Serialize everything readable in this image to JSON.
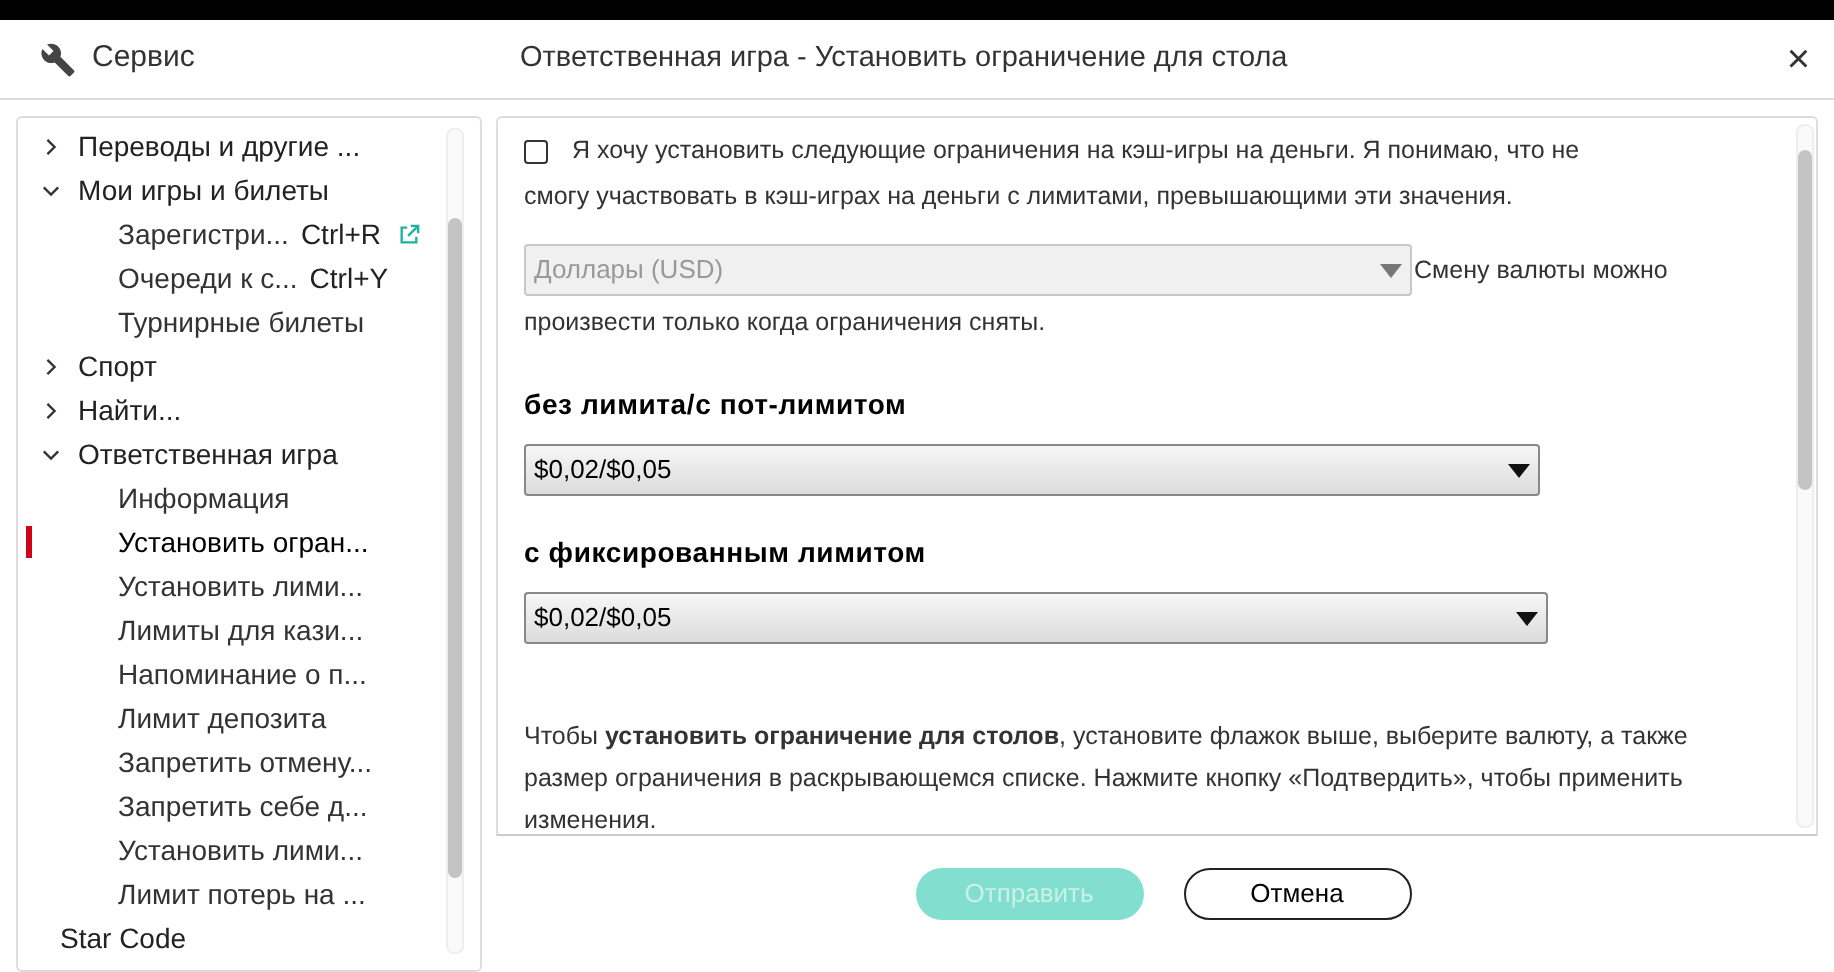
{
  "window": {
    "menu_label": "Сервис",
    "title": "Ответственная игра - Установить ограничение для стола",
    "close": "×"
  },
  "sidebar": {
    "items": [
      {
        "label": "Переводы и другие ...",
        "expanded": false
      },
      {
        "label": "Мои игры и билеты",
        "expanded": true,
        "children": [
          {
            "label": "Зарегистри...",
            "shortcut": "Ctrl+R",
            "external": true,
            "selected": false
          },
          {
            "label": "Очереди к с...",
            "shortcut": "Ctrl+Y",
            "selected": false
          },
          {
            "label": "Турнирные билеты",
            "selected": false
          }
        ]
      },
      {
        "label": "Спорт",
        "expanded": false
      },
      {
        "label": "Найти...",
        "expanded": false
      },
      {
        "label": "Ответственная игра",
        "expanded": true,
        "children": [
          {
            "label": "Информация",
            "selected": false
          },
          {
            "label": "Установить огран...",
            "selected": true
          },
          {
            "label": "Установить лими...",
            "selected": false
          },
          {
            "label": "Лимиты для кази...",
            "selected": false
          },
          {
            "label": "Напоминание о п...",
            "selected": false
          },
          {
            "label": "Лимит депозита",
            "selected": false
          },
          {
            "label": "Запретить отмену...",
            "selected": false
          },
          {
            "label": "Запретить себе д...",
            "selected": false
          },
          {
            "label": "Установить лими...",
            "selected": false
          },
          {
            "label": "Лимит потерь на ...",
            "selected": false
          }
        ]
      },
      {
        "label": "Star Code"
      }
    ]
  },
  "main": {
    "agree": {
      "checked": false,
      "label_lines": [
        "Я хочу установить следующие ограничения на кэш-игры на деньги. Я понимаю, что не",
        "смогу участвовать в кэш-играх на деньги с лимитами, превышающими эти значения."
      ]
    },
    "currency": {
      "value": "Доллары (USD)",
      "disabled": true,
      "note_lines": [
        "Смену валюты можно",
        "произвести только когда ограничения сняты."
      ]
    },
    "limits": [
      {
        "heading": "без лимита/с пот-лимитом",
        "value": "$0,02/$0,05"
      },
      {
        "heading": "с фиксированным лимитом",
        "value": "$0,02/$0,05"
      }
    ],
    "help": "Чтобы **установить ограничение для столов**, установите флажок выше, выберите валюту, а также размер ограничения в раскрывающемся списке. Нажмите кнопку «Подтвердить», чтобы применить изменения."
  },
  "buttons": [
    {
      "label": "Отправить",
      "disabled": true
    },
    {
      "label": "Отмена",
      "disabled": false
    }
  ]
}
